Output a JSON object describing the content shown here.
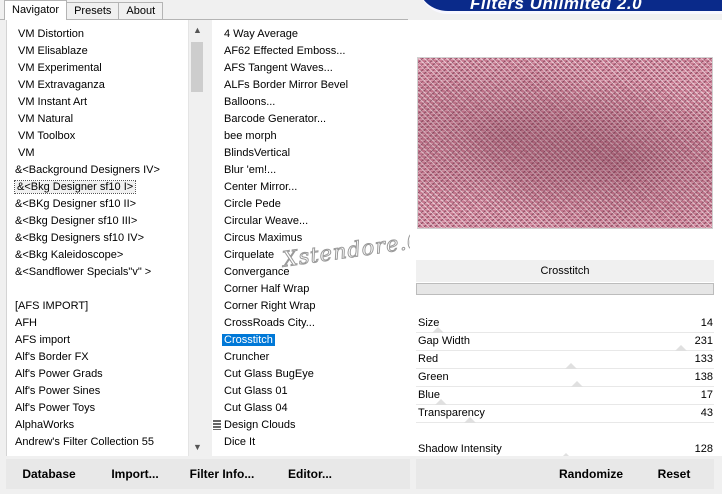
{
  "tabs": [
    "Navigator",
    "Presets",
    "About"
  ],
  "banner_title": "Filters Unlimited 2.0",
  "categories": [
    "VM Distortion",
    "VM Elisablaze",
    "VM Experimental",
    "VM Extravaganza",
    "VM Instant Art",
    "VM Natural",
    "VM Toolbox",
    "VM",
    "&<Background Designers IV>",
    "&<Bkg Designer sf10 I>",
    "&<BKg Designer sf10 II>",
    "&<Bkg Designer sf10 III>",
    "&<Bkg Designers sf10 IV>",
    "&<Bkg Kaleidoscope>",
    "&<Sandflower Specials\"v\" >",
    "",
    "[AFS IMPORT]",
    "AFH",
    "AFS import",
    "Alf's Border FX",
    "Alf's Power Grads",
    "Alf's Power Sines",
    "Alf's Power Toys",
    "AlphaWorks",
    "Andrew's Filter Collection 55"
  ],
  "filters": [
    "4 Way Average",
    "AF62 Effected Emboss...",
    "AFS Tangent Waves...",
    "ALFs Border Mirror Bevel",
    "Balloons...",
    "Barcode Generator...",
    "bee morph",
    "BlindsVertical",
    "Blur 'em!...",
    "Center Mirror...",
    "Circle Pede",
    "Circular Weave...",
    "Circus Maximus",
    "Cirquelate",
    "Convergance",
    "Corner Half Wrap",
    "Corner Right Wrap",
    "CrossRoads City...",
    "Crosstitch",
    "Cruncher",
    "Cut Glass  BugEye",
    "Cut Glass 01",
    "Cut Glass 04",
    "Design Clouds",
    "Dice It"
  ],
  "selected_filter": "Crosstitch",
  "watermark": "Xstendore.06",
  "params": [
    {
      "name": "Size",
      "value": "14",
      "level": 14
    },
    {
      "name": "Gap Width",
      "value": "231",
      "level": 231
    },
    {
      "name": "Red",
      "value": "133",
      "level": 133
    },
    {
      "name": "Green",
      "value": "138",
      "level": 138
    },
    {
      "name": "Blue",
      "value": "17",
      "level": 17
    },
    {
      "name": "Transparency",
      "value": "43",
      "level": 43
    },
    {
      "name": "Shadow Intensity",
      "value": "128",
      "level": 128
    }
  ],
  "buttons": {
    "database": "Database",
    "import": "Import...",
    "filter_info": "Filter Info...",
    "editor": "Editor...",
    "randomize": "Randomize",
    "reset": "Reset"
  },
  "colors": {
    "selection": "#0078d7",
    "banner": "#0a2a8a",
    "preview": "#c97b92"
  }
}
